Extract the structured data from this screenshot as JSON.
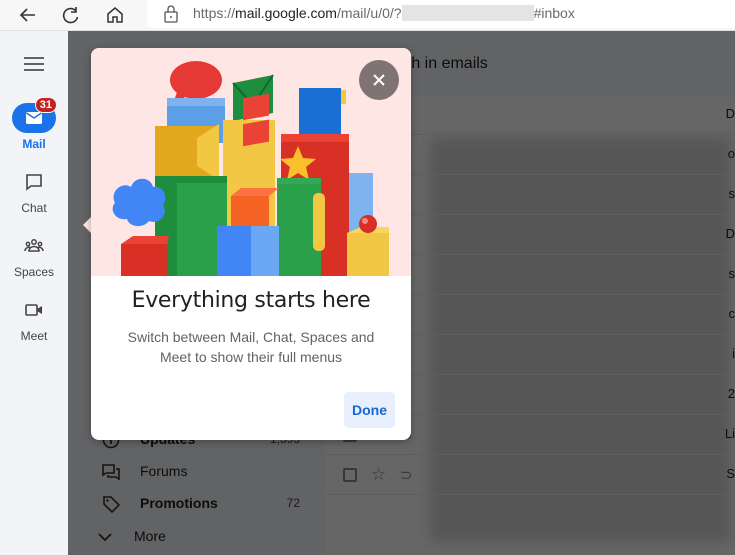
{
  "browser": {
    "url_prefix": "https://",
    "url_host": "mail.google.com",
    "url_path": "/mail/u/0/",
    "url_redacted_visible": "?",
    "url_suffix": "#inbox"
  },
  "rail": {
    "items": [
      {
        "label": "Mail",
        "icon": "mail-icon",
        "badge": "31",
        "active": true
      },
      {
        "label": "Chat",
        "icon": "chat-icon"
      },
      {
        "label": "Spaces",
        "icon": "spaces-icon"
      },
      {
        "label": "Meet",
        "icon": "meet-icon"
      }
    ]
  },
  "search": {
    "placeholder_visible": "rch in emails"
  },
  "folders": [
    {
      "name": "Updates",
      "count": "1,393",
      "icon": "info-icon",
      "bold": true
    },
    {
      "name": "Forums",
      "count": "",
      "icon": "forum-icon",
      "bold": false
    },
    {
      "name": "Promotions",
      "count": "72",
      "icon": "tag-icon",
      "bold": true
    },
    {
      "name": "More",
      "count": "",
      "icon": "chevron-down-icon",
      "bold": false
    }
  ],
  "email_rows_edge_text": [
    "D",
    "o",
    "s",
    "D",
    "s",
    "c",
    "i",
    "2",
    "Li",
    "S"
  ],
  "popup": {
    "title": "Everything starts here",
    "body": "Switch between Mail, Chat, Spaces and Meet to show their full menus",
    "done_label": "Done",
    "close_label": "Close"
  },
  "colors": {
    "accent": "#1a73e8",
    "badge": "#c5221f",
    "hero_bg": "#fde6e4",
    "close_bg": "#7f7473",
    "done_bg": "#e8f0fe",
    "done_text": "#1967d2"
  }
}
